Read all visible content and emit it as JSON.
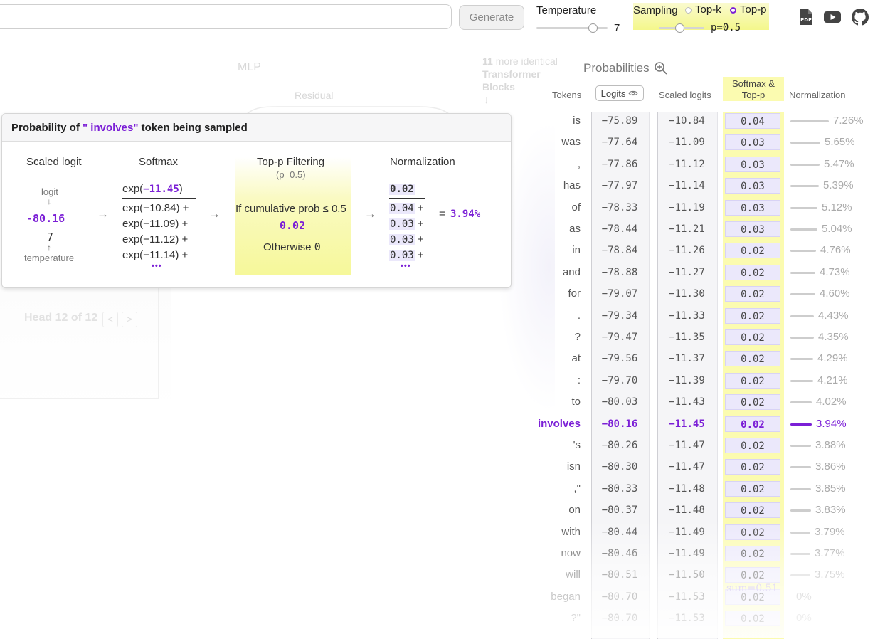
{
  "top_bar": {
    "prompt_value": "",
    "generate_label": "Generate",
    "temperature_label": "Temperature",
    "temperature_value": "7",
    "sampling_label": "Sampling",
    "topk_label": "Top-k",
    "topp_label": "Top-p",
    "topp_value": "p=0.5",
    "selected_sampling": "Top-p"
  },
  "icons": {
    "pdf": "pdf-icon",
    "youtube": "youtube-icon",
    "github": "github-icon",
    "zoom": "zoom-in-icon",
    "eye": "eye-icon"
  },
  "background_diagram": {
    "mlp": "MLP",
    "residual": "Residual",
    "blocks_count": "11",
    "blocks_text_1": "more identical",
    "blocks_text_2": "Transformer",
    "blocks_text_3": "Blocks",
    "head_label": "Head 12 of 12"
  },
  "probabilities": {
    "title": "Probabilities",
    "col_tokens": "Tokens",
    "col_logits": "Logits",
    "col_scaled": "Scaled logits",
    "col_softmax_1": "Softmax &",
    "col_softmax_2": "Top-p",
    "col_norm": "Normalization",
    "sum_label": "sum=0.51",
    "rows": [
      {
        "token": "is",
        "logit": "−75.89",
        "scaled": "−10.84",
        "prob": "0.04",
        "norm": "7.26%",
        "frac": 0.0726
      },
      {
        "token": "was",
        "logit": "−77.64",
        "scaled": "−11.09",
        "prob": "0.03",
        "norm": "5.65%",
        "frac": 0.0565
      },
      {
        "token": ",",
        "logit": "−77.86",
        "scaled": "−11.12",
        "prob": "0.03",
        "norm": "5.47%",
        "frac": 0.0547
      },
      {
        "token": "has",
        "logit": "−77.97",
        "scaled": "−11.14",
        "prob": "0.03",
        "norm": "5.39%",
        "frac": 0.0539
      },
      {
        "token": "of",
        "logit": "−78.33",
        "scaled": "−11.19",
        "prob": "0.03",
        "norm": "5.12%",
        "frac": 0.0512
      },
      {
        "token": "as",
        "logit": "−78.44",
        "scaled": "−11.21",
        "prob": "0.03",
        "norm": "5.04%",
        "frac": 0.0504
      },
      {
        "token": "in",
        "logit": "−78.84",
        "scaled": "−11.26",
        "prob": "0.02",
        "norm": "4.76%",
        "frac": 0.0476
      },
      {
        "token": "and",
        "logit": "−78.88",
        "scaled": "−11.27",
        "prob": "0.02",
        "norm": "4.73%",
        "frac": 0.0473
      },
      {
        "token": "for",
        "logit": "−79.07",
        "scaled": "−11.30",
        "prob": "0.02",
        "norm": "4.60%",
        "frac": 0.046
      },
      {
        "token": ".",
        "logit": "−79.34",
        "scaled": "−11.33",
        "prob": "0.02",
        "norm": "4.43%",
        "frac": 0.0443
      },
      {
        "token": "?",
        "logit": "−79.47",
        "scaled": "−11.35",
        "prob": "0.02",
        "norm": "4.35%",
        "frac": 0.0435
      },
      {
        "token": "at",
        "logit": "−79.56",
        "scaled": "−11.37",
        "prob": "0.02",
        "norm": "4.29%",
        "frac": 0.0429
      },
      {
        "token": ":",
        "logit": "−79.70",
        "scaled": "−11.39",
        "prob": "0.02",
        "norm": "4.21%",
        "frac": 0.0421
      },
      {
        "token": "to",
        "logit": "−80.03",
        "scaled": "−11.43",
        "prob": "0.02",
        "norm": "4.02%",
        "frac": 0.0402
      },
      {
        "token": "involves",
        "logit": "−80.16",
        "scaled": "−11.45",
        "prob": "0.02",
        "norm": "3.94%",
        "frac": 0.0394,
        "highlight": true
      },
      {
        "token": "'s",
        "logit": "−80.26",
        "scaled": "−11.47",
        "prob": "0.02",
        "norm": "3.88%",
        "frac": 0.0388
      },
      {
        "token": "isn",
        "logit": "−80.30",
        "scaled": "−11.47",
        "prob": "0.02",
        "norm": "3.86%",
        "frac": 0.0386
      },
      {
        "token": ",\"",
        "logit": "−80.33",
        "scaled": "−11.48",
        "prob": "0.02",
        "norm": "3.85%",
        "frac": 0.0385
      },
      {
        "token": "on",
        "logit": "−80.37",
        "scaled": "−11.48",
        "prob": "0.02",
        "norm": "3.83%",
        "frac": 0.0383
      },
      {
        "token": "with",
        "logit": "−80.44",
        "scaled": "−11.49",
        "prob": "0.02",
        "norm": "3.79%",
        "frac": 0.0379
      },
      {
        "token": "now",
        "logit": "−80.46",
        "scaled": "−11.49",
        "prob": "0.02",
        "norm": "3.77%",
        "frac": 0.0377
      },
      {
        "token": "will",
        "logit": "−80.51",
        "scaled": "−11.50",
        "prob": "0.02",
        "norm": "3.75%",
        "frac": 0.0375
      },
      {
        "token": "began",
        "logit": "−80.70",
        "scaled": "−11.53",
        "prob": "0.02",
        "norm": "0%",
        "frac": 0
      },
      {
        "token": "?\"",
        "logit": "−80.70",
        "scaled": "−11.53",
        "prob": "0.02",
        "norm": "0%",
        "frac": 0
      }
    ]
  },
  "popup": {
    "title_prefix": "Probability of ",
    "token": "\" involves\"",
    "title_suffix": " token being sampled",
    "scaled_logit_title": "Scaled logit",
    "logit_label": "logit",
    "logit_value": "-80.16",
    "temperature_value": "7",
    "temperature_label": "temperature",
    "softmax_title": "Softmax",
    "softmax_num_prefix": "exp(",
    "softmax_num_value": "−11.45",
    "softmax_num_suffix": ")",
    "softmax_terms": [
      "exp(−10.84) +",
      "exp(−11.09) +",
      "exp(−11.12) +",
      "exp(−11.14) +"
    ],
    "topp_title": "Top-p Filtering",
    "topp_param": "(p=0.5)",
    "topp_condition": "If cumulative prob ≤ 0.5",
    "topp_value": "0.02",
    "topp_otherwise_text": "Otherwise",
    "topp_otherwise_value": "0",
    "norm_title": "Normalization",
    "norm_num": "0.02",
    "norm_terms": [
      "0.04",
      "0.03",
      "0.03",
      "0.03"
    ],
    "plus": "+",
    "equals": "=",
    "result": "3.94%",
    "dots": "•••",
    "arrow": "→",
    "arrow_down": "↓",
    "arrow_up": "↑"
  },
  "colors": {
    "accent": "#7b1fd6",
    "highlight_yellow": "#f6f89a",
    "chip": "#ebe8fb"
  }
}
